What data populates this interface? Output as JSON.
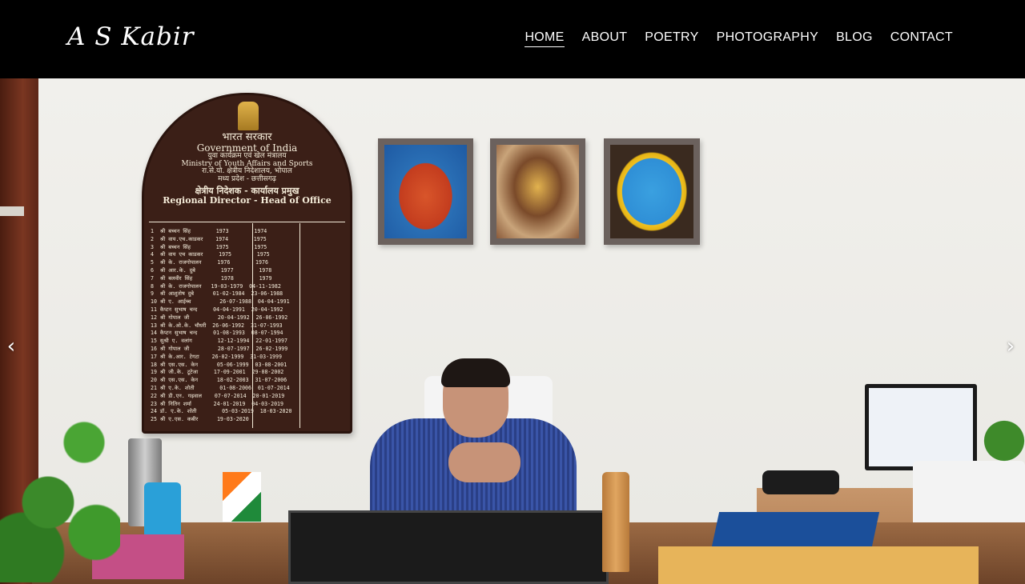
{
  "site": {
    "logo": "A S Kabir"
  },
  "nav": {
    "items": [
      {
        "label": "HOME",
        "active": true
      },
      {
        "label": "ABOUT",
        "active": false
      },
      {
        "label": "POETRY",
        "active": false
      },
      {
        "label": "PHOTOGRAPHY",
        "active": false
      },
      {
        "label": "BLOG",
        "active": false
      },
      {
        "label": "CONTACT",
        "active": false
      }
    ]
  },
  "carousel": {
    "prev_icon": "‹",
    "next_icon": "›"
  },
  "board": {
    "line1": "भारत सरकार",
    "line2": "Government of India",
    "line3": "युवा कार्यक्रम एवं खेल मंत्रालय",
    "line4": "Ministry of Youth Affairs and Sports",
    "line5": "रा.से.यो. क्षेत्रीय निदेशालय, भोपाल",
    "line6": "मध्य प्रदेश - छत्तीसगढ़",
    "line7": "क्षेत्रीय निदेशक - कार्यालय प्रमुख",
    "line8": "Regional Director - Head of Office",
    "rows": [
      "1  श्री बच्चन सिंह        1973        1974",
      "2  श्री वाय.एच.काडकर    1974        1975",
      "3  श्री बच्चन सिंह        1975        1975",
      "4  श्री वाय एच काडकर     1975        1975",
      "5  श्री के. राजगोपालन     1976        1976",
      "6  श्री आर.के. दुबे        1977        1978",
      "7  श्री बलवीर सिंह         1978        1979",
      "8  श्री के. राजगोपालन   19-03-1979  04-11-1982",
      "9  श्री आशुतोष दुबे      01-02-1984  23-06-1988",
      "10 श्री ए. आईच्च         26-07-1988  04-04-1991",
      "11 कैप्टन सुभाष चन्द     04-04-1991  20-04-1992",
      "12 श्री गोपाल जी         20-04-1992  26-06-1992",
      "13 श्री के.ओ.के. चौधरी  26-06-1992  31-07-1993",
      "14 कैप्टन सुभाष चन्द     01-08-1993  08-07-1994",
      "15 सुश्री ए. वलांग        12-12-1994  22-01-1997",
      "16 श्री गोपाल जी         28-07-1997  26-02-1999",
      "17 श्री के.आर. टेगटा    26-02-1999  31-03-1999",
      "18 श्री एस.एस. केन      05-06-1999  03-08-2001",
      "19 श्री जी.के. टूटेजा     17-09-2001  29-08-2002",
      "20 श्री एस.एस. केन      18-02-2003  31-07-2006",
      "21 श्री ए.के. शोती        01-08-2006  01-07-2014",
      "22 श्री डी.एन. गढ़वाल    07-07-2014  20-01-2019",
      "23 श्री नितिन शर्मा       24-01-2019  04-03-2019",
      "24 डॉ. ए.के. शोती        05-03-2019  18-03-2020",
      "25 श्री ए.एस. कबीर      19-03-2020"
    ]
  }
}
